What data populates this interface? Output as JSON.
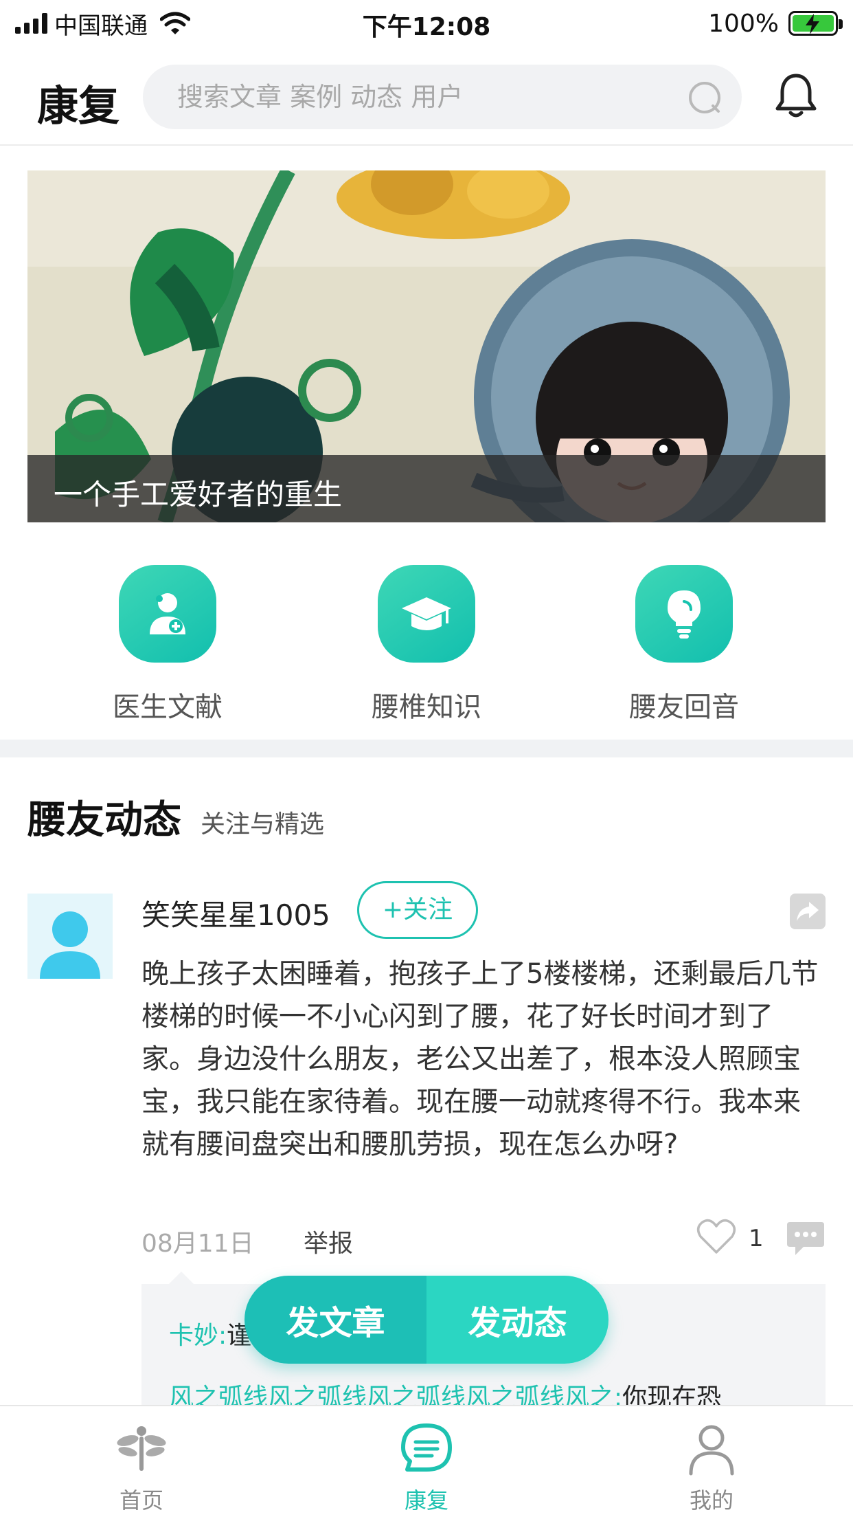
{
  "status_bar": {
    "carrier": "中国联通",
    "time": "下午12:08",
    "battery": "100%"
  },
  "header": {
    "title": "康复",
    "search_placeholder": "搜索文章 案例 动态 用户"
  },
  "banner": {
    "caption": "一个手工爱好者的重生"
  },
  "categories": [
    {
      "label": "医生文献",
      "icon": "doctor-icon"
    },
    {
      "label": "腰椎知识",
      "icon": "graduation-cap-icon"
    },
    {
      "label": "腰友回音",
      "icon": "lightbulb-icon"
    }
  ],
  "section": {
    "title": "腰友动态",
    "subtitle": "关注与精选"
  },
  "post": {
    "username": "笑笑星星1005",
    "follow_label": "+关注",
    "content": "晚上孩子太困睡着，抱孩子上了5楼楼梯，还剩最后几节楼梯的时候一不小心闪到了腰，花了好长时间才到了家。身边没什么朋友，老公又出差了，根本没人照顾宝宝，我只能在家待着。现在腰一动就疼得不行。我本来就有腰间盘突出和腰肌劳损，现在怎么办呀?",
    "date": "08月11日",
    "report_label": "举报",
    "like_count": "1",
    "comments": [
      {
        "user": "卡妙:",
        "text": "谨"
      },
      {
        "user": "风之弧线风之弧线风之弧线风之弧线风之:",
        "text": "你现在恐"
      }
    ]
  },
  "fab": {
    "article_label": "发文章",
    "post_label": "发动态"
  },
  "tabbar": {
    "items": [
      {
        "label": "首页",
        "icon": "dragonfly-icon",
        "active": false
      },
      {
        "label": "康复",
        "icon": "chat-bubble-icon",
        "active": true
      },
      {
        "label": "我的",
        "icon": "person-icon",
        "active": false
      }
    ]
  },
  "colors": {
    "accent": "#1ec2b0",
    "fab_left": "#1dbfb6",
    "fab_right": "#2bd6c2",
    "battery": "#37c83c"
  }
}
